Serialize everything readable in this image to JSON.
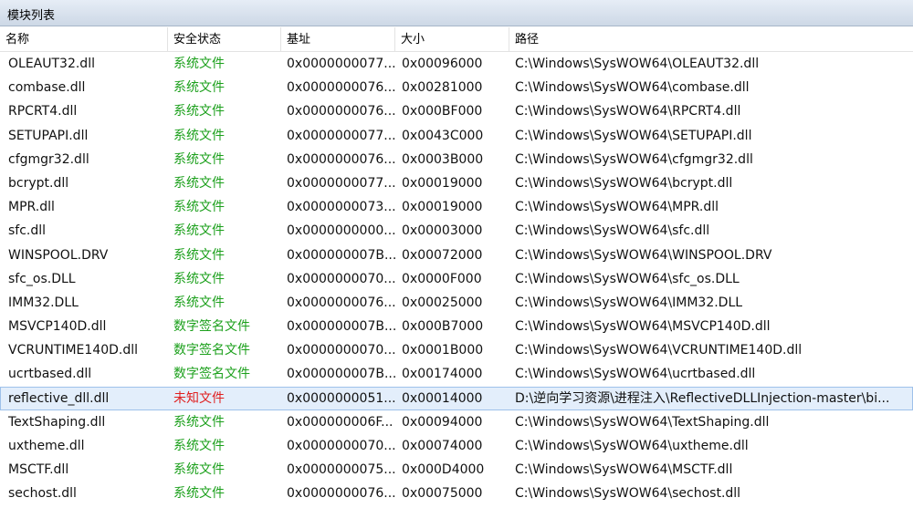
{
  "panel": {
    "title": "模块列表"
  },
  "columns": [
    "名称",
    "安全状态",
    "基址",
    "大小",
    "路径"
  ],
  "colors": {
    "system": "#1ca01c",
    "unknown": "#e02020",
    "selected_bg": "#e3eefb"
  },
  "rows": [
    {
      "name": "OLEAUT32.dll",
      "status": "系统文件",
      "status_type": "system",
      "base": "0x0000000077...",
      "size": "0x00096000",
      "path": "C:\\Windows\\SysWOW64\\OLEAUT32.dll"
    },
    {
      "name": "combase.dll",
      "status": "系统文件",
      "status_type": "system",
      "base": "0x0000000076...",
      "size": "0x00281000",
      "path": "C:\\Windows\\SysWOW64\\combase.dll"
    },
    {
      "name": "RPCRT4.dll",
      "status": "系统文件",
      "status_type": "system",
      "base": "0x0000000076...",
      "size": "0x000BF000",
      "path": "C:\\Windows\\SysWOW64\\RPCRT4.dll"
    },
    {
      "name": "SETUPAPI.dll",
      "status": "系统文件",
      "status_type": "system",
      "base": "0x0000000077...",
      "size": "0x0043C000",
      "path": "C:\\Windows\\SysWOW64\\SETUPAPI.dll"
    },
    {
      "name": "cfgmgr32.dll",
      "status": "系统文件",
      "status_type": "system",
      "base": "0x0000000076...",
      "size": "0x0003B000",
      "path": "C:\\Windows\\SysWOW64\\cfgmgr32.dll"
    },
    {
      "name": "bcrypt.dll",
      "status": "系统文件",
      "status_type": "system",
      "base": "0x0000000077...",
      "size": "0x00019000",
      "path": "C:\\Windows\\SysWOW64\\bcrypt.dll"
    },
    {
      "name": "MPR.dll",
      "status": "系统文件",
      "status_type": "system",
      "base": "0x0000000073...",
      "size": "0x00019000",
      "path": "C:\\Windows\\SysWOW64\\MPR.dll"
    },
    {
      "name": "sfc.dll",
      "status": "系统文件",
      "status_type": "system",
      "base": "0x0000000000...",
      "size": "0x00003000",
      "path": "C:\\Windows\\SysWOW64\\sfc.dll"
    },
    {
      "name": "WINSPOOL.DRV",
      "status": "系统文件",
      "status_type": "system",
      "base": "0x000000007B...",
      "size": "0x00072000",
      "path": "C:\\Windows\\SysWOW64\\WINSPOOL.DRV"
    },
    {
      "name": "sfc_os.DLL",
      "status": "系统文件",
      "status_type": "system",
      "base": "0x0000000070...",
      "size": "0x0000F000",
      "path": "C:\\Windows\\SysWOW64\\sfc_os.DLL"
    },
    {
      "name": "IMM32.DLL",
      "status": "系统文件",
      "status_type": "system",
      "base": "0x0000000076...",
      "size": "0x00025000",
      "path": "C:\\Windows\\SysWOW64\\IMM32.DLL"
    },
    {
      "name": "MSVCP140D.dll",
      "status": "数字签名文件",
      "status_type": "system",
      "base": "0x000000007B...",
      "size": "0x000B7000",
      "path": "C:\\Windows\\SysWOW64\\MSVCP140D.dll"
    },
    {
      "name": "VCRUNTIME140D.dll",
      "status": "数字签名文件",
      "status_type": "system",
      "base": "0x0000000070...",
      "size": "0x0001B000",
      "path": "C:\\Windows\\SysWOW64\\VCRUNTIME140D.dll"
    },
    {
      "name": "ucrtbased.dll",
      "status": "数字签名文件",
      "status_type": "system",
      "base": "0x000000007B...",
      "size": "0x00174000",
      "path": "C:\\Windows\\SysWOW64\\ucrtbased.dll"
    },
    {
      "name": "reflective_dll.dll",
      "status": "未知文件",
      "status_type": "unknown",
      "selected": true,
      "base": "0x0000000051...",
      "size": "0x00014000",
      "path": "D:\\逆向学习资源\\进程注入\\ReflectiveDLLInjection-master\\bi..."
    },
    {
      "name": "TextShaping.dll",
      "status": "系统文件",
      "status_type": "system",
      "base": "0x000000006F...",
      "size": "0x00094000",
      "path": "C:\\Windows\\SysWOW64\\TextShaping.dll"
    },
    {
      "name": "uxtheme.dll",
      "status": "系统文件",
      "status_type": "system",
      "base": "0x0000000070...",
      "size": "0x00074000",
      "path": "C:\\Windows\\SysWOW64\\uxtheme.dll"
    },
    {
      "name": "MSCTF.dll",
      "status": "系统文件",
      "status_type": "system",
      "base": "0x0000000075...",
      "size": "0x000D4000",
      "path": "C:\\Windows\\SysWOW64\\MSCTF.dll"
    },
    {
      "name": "sechost.dll",
      "status": "系统文件",
      "status_type": "system",
      "base": "0x0000000076...",
      "size": "0x00075000",
      "path": "C:\\Windows\\SysWOW64\\sechost.dll"
    }
  ]
}
